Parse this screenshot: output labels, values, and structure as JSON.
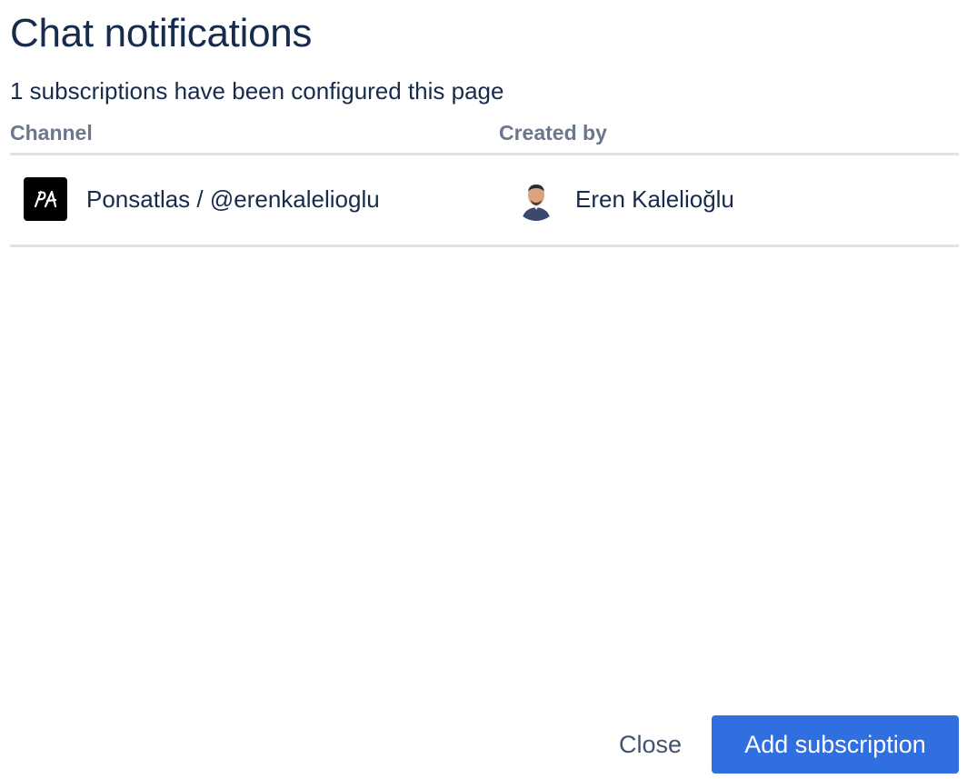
{
  "dialog": {
    "title": "Chat notifications",
    "summary": "1 subscriptions have been configured this page"
  },
  "table": {
    "headers": {
      "channel": "Channel",
      "created_by": "Created by"
    },
    "rows": [
      {
        "channel": "Ponsatlas / @erenkalelioglu",
        "workspace_logo_icon": "workspace-logo-icon",
        "created_by": "Eren Kalelioğlu",
        "avatar_icon": "user-avatar"
      }
    ]
  },
  "footer": {
    "close_label": "Close",
    "add_label": "Add subscription"
  },
  "colors": {
    "primary": "#2f6fdf",
    "text": "#172b4d",
    "subtle_text": "#6b778c",
    "divider": "#dfe1e6"
  }
}
